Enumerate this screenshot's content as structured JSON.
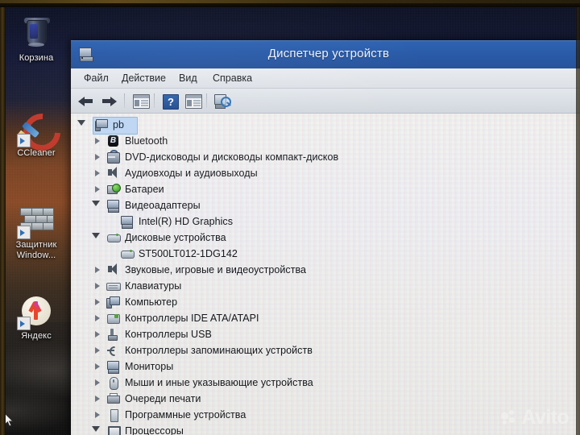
{
  "desktop": {
    "icons": [
      {
        "name": "recycle-bin",
        "label": "Корзина"
      },
      {
        "name": "ccleaner",
        "label": "CCleaner"
      },
      {
        "name": "windows-defender",
        "label": "Защитник\nWindow..."
      },
      {
        "name": "yandex",
        "label": "Яндекс"
      }
    ],
    "defender_label_line1": "Защитник",
    "defender_label_line2": "Window..."
  },
  "window": {
    "title": "Диспетчер устройств",
    "icon": "device-manager-icon",
    "menu": [
      {
        "label": "Файл"
      },
      {
        "label": "Действие"
      },
      {
        "label": "Вид"
      },
      {
        "label": "Справка"
      }
    ],
    "toolbar": [
      {
        "name": "back-button",
        "icon": "arrow-left-icon"
      },
      {
        "name": "forward-button",
        "icon": "arrow-right-icon"
      },
      {
        "name": "show-hide-console-tree-button",
        "icon": "console-tree-icon"
      },
      {
        "name": "help-button",
        "icon": "question-mark-icon"
      },
      {
        "name": "properties-button",
        "icon": "properties-panel-icon"
      },
      {
        "name": "scan-for-hardware-changes-button",
        "icon": "scan-hardware-icon"
      }
    ]
  },
  "tree": {
    "root": {
      "label": "pb",
      "icon": "computer-icon",
      "expanded": true,
      "selected": true
    },
    "nodes": [
      {
        "label": "Bluetooth",
        "icon": "bluetooth-icon",
        "state": "collapsed",
        "depth": 1
      },
      {
        "label": "DVD-дисководы и дисководы компакт-дисков",
        "icon": "dvd-drive-icon",
        "state": "collapsed",
        "depth": 1
      },
      {
        "label": "Аудиовходы и аудиовыходы",
        "icon": "speaker-icon",
        "state": "collapsed",
        "depth": 1
      },
      {
        "label": "Батареи",
        "icon": "battery-icon",
        "state": "collapsed",
        "depth": 1
      },
      {
        "label": "Видеоадаптеры",
        "icon": "display-adapter-icon",
        "state": "expanded",
        "depth": 1
      },
      {
        "label": "Intel(R) HD Graphics",
        "icon": "display-adapter-icon",
        "state": "leaf",
        "depth": 2
      },
      {
        "label": "Дисковые устройства",
        "icon": "disk-drive-icon",
        "state": "expanded",
        "depth": 1
      },
      {
        "label": "ST500LT012-1DG142",
        "icon": "disk-drive-icon",
        "state": "leaf",
        "depth": 2
      },
      {
        "label": "Звуковые, игровые и видеоустройства",
        "icon": "speaker-icon",
        "state": "collapsed",
        "depth": 1
      },
      {
        "label": "Клавиатуры",
        "icon": "keyboard-icon",
        "state": "collapsed",
        "depth": 1
      },
      {
        "label": "Компьютер",
        "icon": "computer-icon",
        "state": "collapsed",
        "depth": 1
      },
      {
        "label": "Контроллеры IDE ATA/ATAPI",
        "icon": "ide-controller-icon",
        "state": "collapsed",
        "depth": 1
      },
      {
        "label": "Контроллеры USB",
        "icon": "usb-icon",
        "state": "collapsed",
        "depth": 1
      },
      {
        "label": "Контроллеры запоминающих устройств",
        "icon": "storage-controller-icon",
        "state": "collapsed",
        "depth": 1
      },
      {
        "label": "Мониторы",
        "icon": "monitor-icon",
        "state": "collapsed",
        "depth": 1
      },
      {
        "label": "Мыши и иные указывающие устройства",
        "icon": "mouse-icon",
        "state": "collapsed",
        "depth": 1
      },
      {
        "label": "Очереди печати",
        "icon": "printer-icon",
        "state": "collapsed",
        "depth": 1
      },
      {
        "label": "Программные устройства",
        "icon": "software-device-icon",
        "state": "collapsed",
        "depth": 1
      },
      {
        "label": "Процессоры",
        "icon": "processor-icon",
        "state": "expanded",
        "depth": 1
      }
    ]
  },
  "watermark": {
    "text": "Avito",
    "logo": "avito-dots-logo"
  },
  "colors": {
    "titlebar": "#2a5caa",
    "selection": "#bdd6f2",
    "content_bg": "#eeeeea",
    "menu_bg": "#e4e8ed"
  }
}
